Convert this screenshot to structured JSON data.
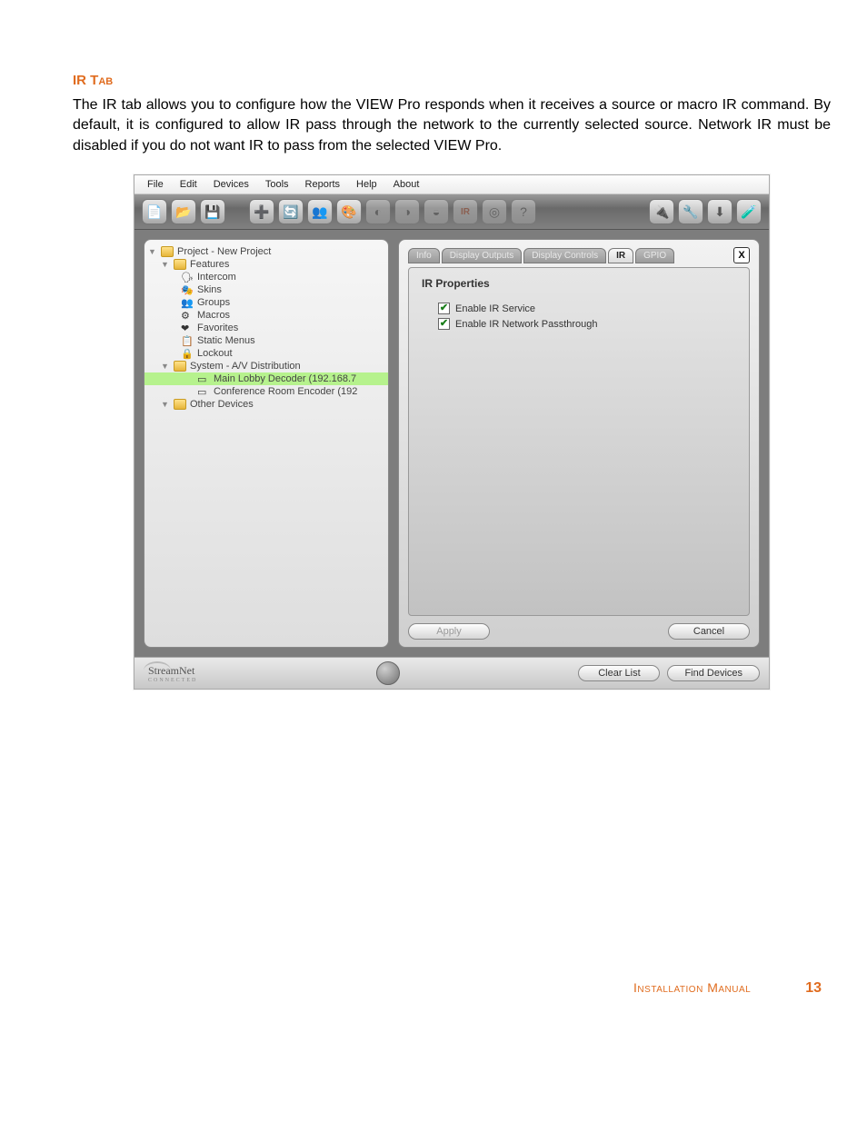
{
  "doc": {
    "section_title": "IR Tab",
    "body_text": "The IR tab allows you to configure how the VIEW Pro responds when it receives a source or macro IR command. By default, it is configured to allow IR pass through the network to the currently selected source. Network IR must be disabled if you do not want IR to pass from the selected VIEW Pro.",
    "footer_title": "Installation Manual",
    "page_number": "13"
  },
  "app": {
    "menubar": [
      "File",
      "Edit",
      "Devices",
      "Tools",
      "Reports",
      "Help",
      "About"
    ],
    "tree": {
      "project": "Project - New Project",
      "features": "Features",
      "feature_items": [
        "Intercom",
        "Skins",
        "Groups",
        "Macros",
        "Favorites",
        "Static Menus",
        "Lockout"
      ],
      "system": "System - A/V Distribution",
      "system_items": [
        {
          "label": "Main Lobby Decoder (192.168.7",
          "selected": true
        },
        {
          "label": "Conference Room Encoder (192",
          "selected": false
        }
      ],
      "other": "Other Devices"
    },
    "panel": {
      "tabs": [
        {
          "label": "Info",
          "active": false
        },
        {
          "label": "Display Outputs",
          "active": false
        },
        {
          "label": "Display Controls",
          "active": false
        },
        {
          "label": "IR",
          "active": true
        },
        {
          "label": "GPIO",
          "active": false
        }
      ],
      "close": "X",
      "title": "IR Properties",
      "checkboxes": [
        {
          "label": "Enable IR Service",
          "checked": true
        },
        {
          "label": "Enable IR Network Passthrough",
          "checked": true
        }
      ],
      "apply": "Apply",
      "cancel": "Cancel"
    },
    "status": {
      "logo_main": "StreamNet",
      "logo_sub": "connected",
      "clear": "Clear List",
      "find": "Find Devices"
    }
  }
}
